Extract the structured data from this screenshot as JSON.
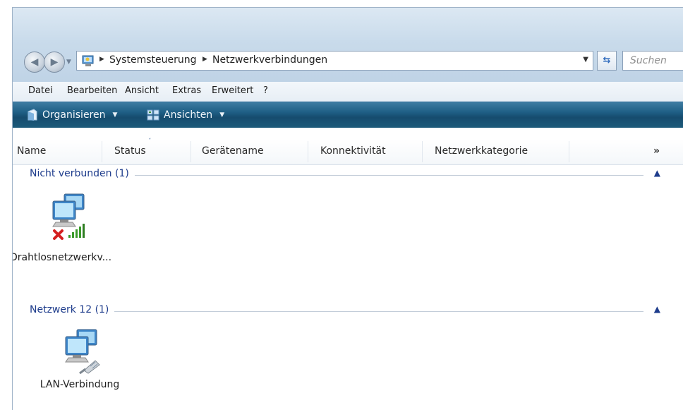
{
  "address_bar": {
    "crumbs": [
      "Systemsteuerung",
      "Netzwerkverbindungen"
    ],
    "search_placeholder": "Suchen"
  },
  "menu": {
    "items": [
      "Datei",
      "Bearbeiten",
      "Ansicht",
      "Extras",
      "Erweitert",
      "?"
    ]
  },
  "toolbar": {
    "organize_label": "Organisieren",
    "views_label": "Ansichten"
  },
  "columns": {
    "headers": [
      "Name",
      "Status",
      "Gerätename",
      "Konnektivität",
      "Netzwerkkategorie"
    ],
    "more_label": "»"
  },
  "groups": [
    {
      "title": "Nicht verbunden (1)",
      "items": [
        {
          "label": "Drahtlosnetzwerkv...",
          "icon": "wireless-network-disconnected-icon"
        }
      ]
    },
    {
      "title": "Netzwerk 12 (1)",
      "items": [
        {
          "label": "LAN-Verbindung",
          "icon": "lan-connection-icon"
        }
      ]
    }
  ],
  "colors": {
    "toolbar": "#1f5f86",
    "group_title": "#1e3c8c",
    "highlight_arrow": "#4a9a2a",
    "error_x": "#d42020",
    "signal_bars": "#3a9a2a"
  }
}
